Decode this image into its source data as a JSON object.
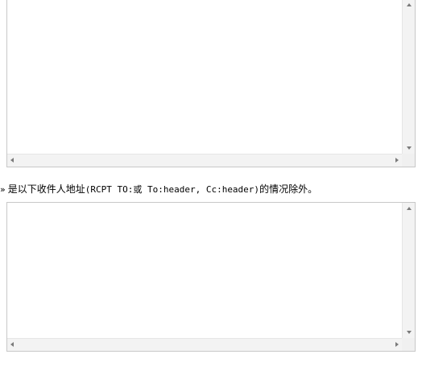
{
  "recipient_notice": {
    "bullet": "»",
    "prefix": "是以下收件人地址",
    "code": "(RCPT TO:或 To:header, Cc:header)",
    "suffix": "的情况除外。"
  },
  "icons": {
    "scroll_up": "triangle-up",
    "scroll_down": "triangle-down",
    "scroll_left": "triangle-left",
    "scroll_right": "triangle-right"
  },
  "colors": {
    "border": "#c8c8c8",
    "scrollbar_track": "#f3f3f3",
    "arrow": "#7a7a7a",
    "text": "#000000"
  }
}
